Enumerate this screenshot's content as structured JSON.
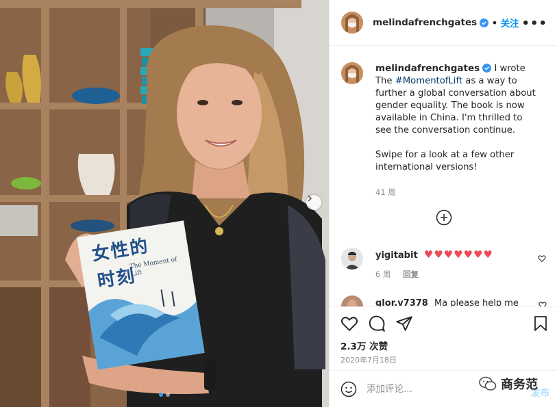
{
  "post": {
    "username": "melindafrenchgates",
    "follow_label": "关注",
    "separator": "•",
    "more_label": "•••",
    "caption": {
      "intro": "I wrote The",
      "hashtag": "#MomentofLift",
      "body": "as a way to further a global conversation about gender equality. The book is now available in China. I'm thrilled to see the conversation continue.",
      "second": "Swipe for a look at a few other international versions!"
    },
    "time_ago": "41 周",
    "likes": "2.3万 次赞",
    "date": "2020年7月18日"
  },
  "book": {
    "title_cn_1": "女性的",
    "title_cn_2": "时刻",
    "title_en": "The Moment of Lift"
  },
  "comments": [
    {
      "username": "yigitabit",
      "text": "♥♥♥♥♥♥♥",
      "time": "6 周",
      "reply_label": "回复"
    },
    {
      "username": "glor.v7378",
      "text": "Ma please help me"
    }
  ],
  "composer": {
    "placeholder": "添加评论...",
    "post_label": "发布"
  },
  "watermark": {
    "text": "商务范"
  },
  "colors": {
    "accent": "#0095f6",
    "heart": "#ed4956",
    "verified": "#3897f0"
  }
}
